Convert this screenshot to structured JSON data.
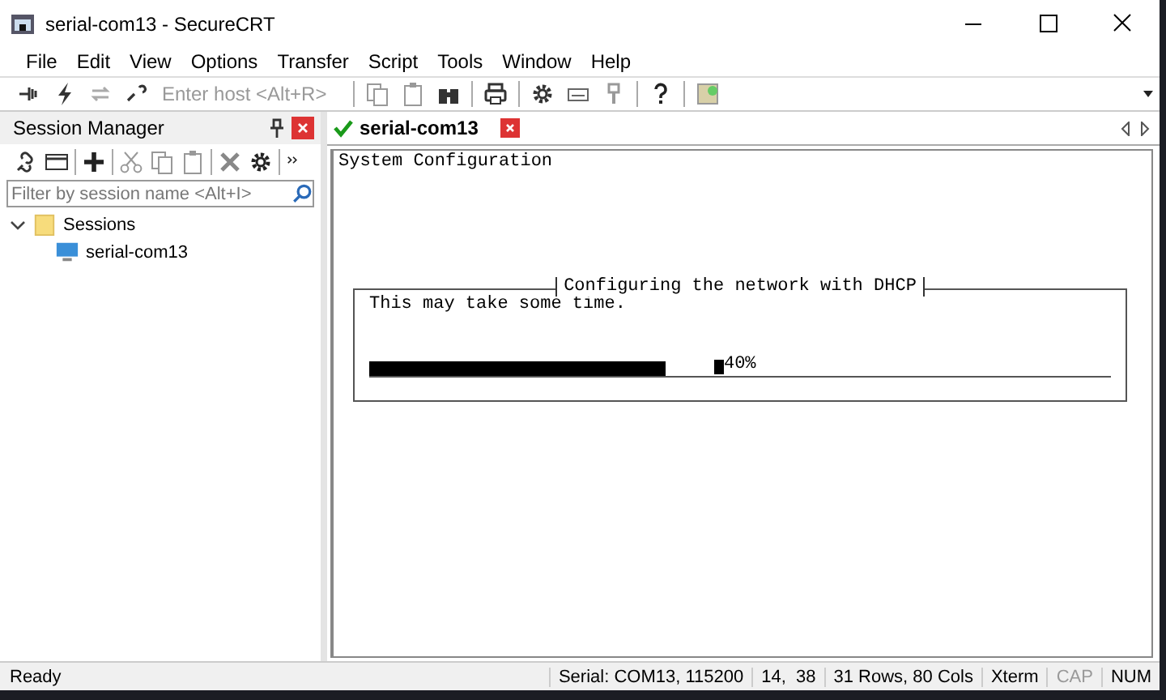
{
  "window": {
    "title": "serial-com13 - SecureCRT"
  },
  "menu": [
    "File",
    "Edit",
    "View",
    "Options",
    "Transfer",
    "Script",
    "Tools",
    "Window",
    "Help"
  ],
  "toolbar": {
    "host_field": {
      "placeholder": "Enter host <Alt+R>"
    }
  },
  "session_manager": {
    "title": "Session Manager",
    "filter": {
      "placeholder": "Filter by session name <Alt+I>"
    },
    "tree": [
      {
        "label": "Sessions",
        "kind": "folder",
        "expanded": true,
        "children": [
          {
            "label": "serial-com13",
            "kind": "session"
          }
        ]
      }
    ]
  },
  "tabs": [
    {
      "label": "serial-com13",
      "selected": true,
      "connected": true
    }
  ],
  "terminal": {
    "header": "System Configuration",
    "dialog": {
      "title": "Configuring the network with DHCP",
      "message": "This may take some time.",
      "progress": {
        "level": 0.4,
        "reading": "40%"
      }
    }
  },
  "status_bar": {
    "message": "Ready",
    "fields": [
      "Serial: COM13, 115200",
      "14,  38",
      "31 Rows, 80 Cols",
      "Xterm"
    ],
    "indicators": [
      {
        "label": "CAP",
        "on": false
      },
      {
        "label": "NUM",
        "on": true
      }
    ]
  }
}
